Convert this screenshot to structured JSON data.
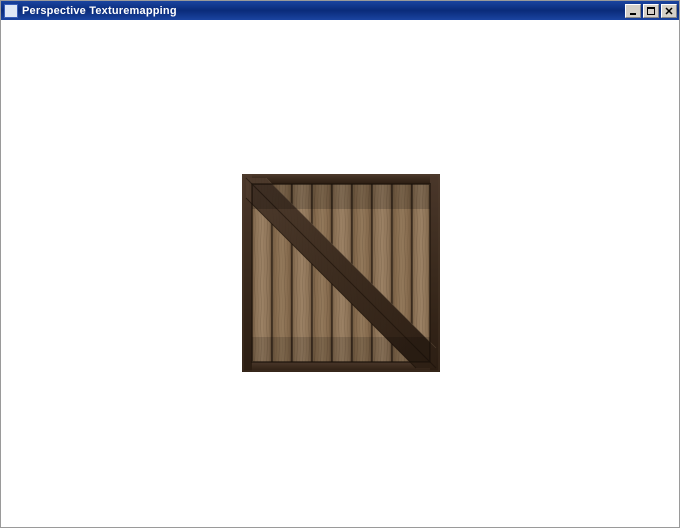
{
  "window": {
    "title": "Perspective Texturemapping",
    "controls": {
      "minimize_name": "minimize-button",
      "maximize_name": "maximize-button",
      "close_name": "close-button"
    }
  },
  "content": {
    "object": "wooden-crate-texture",
    "description": "Rendered textured square (wooden crate) centered in client area"
  }
}
